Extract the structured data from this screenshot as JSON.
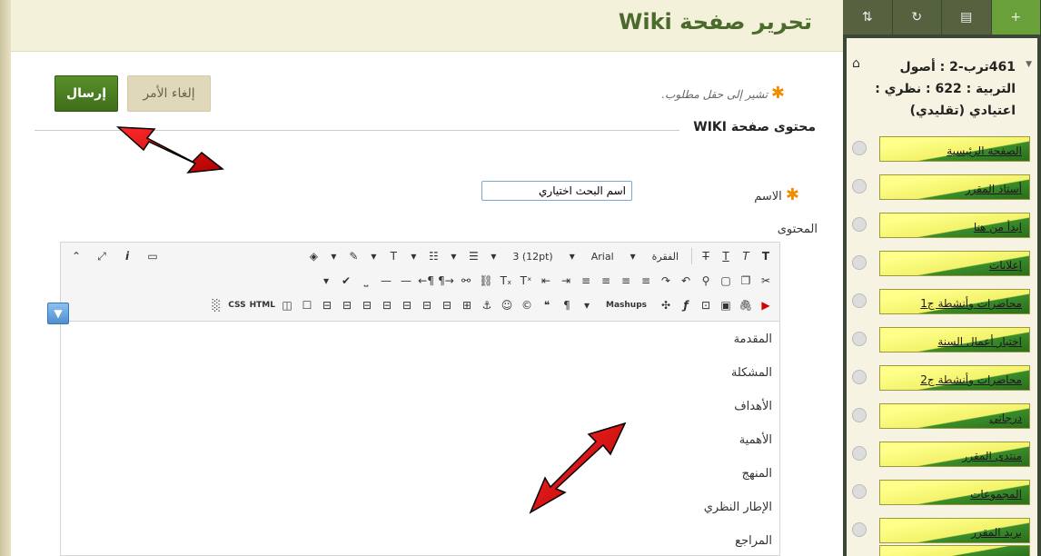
{
  "header": {
    "title": "تحرير صفحة Wiki"
  },
  "actions": {
    "submit": "إرسال",
    "cancel": "إلغاء الأمر"
  },
  "form": {
    "required_note": "تشير إلى حقل مطلوب.",
    "section_title": "محتوى صفحة WIKI",
    "name_label": "الاسم",
    "name_value": "اسم البحث اختياري",
    "content_label": "المحتوى"
  },
  "toolbar": {
    "paragraph_select": "الفقرة",
    "font_select": "Arial",
    "size_select": "3 (12pt)",
    "mashups": "Mashups",
    "html": "HTML",
    "css": "CSS"
  },
  "editor": {
    "lines": [
      "المقدمة",
      "المشكلة",
      "الأهداف",
      "الأهمية",
      "المنهج",
      "الإطار النظري",
      "المراجع"
    ]
  },
  "sidebar": {
    "course_name": "461ترب-2 : أصول التربية : 622 : نظري : اعتيادي (تقليدي)",
    "items": [
      {
        "label": "الصفحة الرئيسية"
      },
      {
        "label": "أستاذ المقرر"
      },
      {
        "label": "ابدأ من هنا"
      },
      {
        "label": "إعلانات"
      },
      {
        "label": "محاضرات وأنشطة ج1"
      },
      {
        "label": "اختبار أعمال السنة"
      },
      {
        "label": "محاضرات وأنشطة ج2"
      },
      {
        "label": "درجاتي"
      },
      {
        "label": "منتدى المقرر"
      },
      {
        "label": "المجموعات"
      },
      {
        "label": "بريد المقرر"
      }
    ]
  }
}
